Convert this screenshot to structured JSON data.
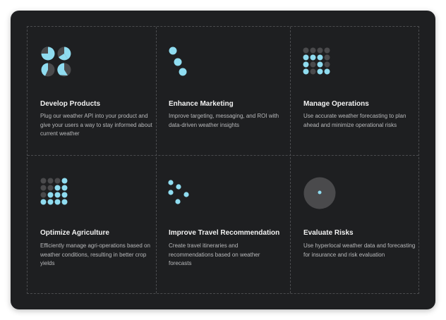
{
  "colors": {
    "accent": "#8fdcf0",
    "muted": "#4a4a4c",
    "panel": "#1e1f21"
  },
  "cards": [
    {
      "title": "Develop Products",
      "description": "Plug our weather API into your product and give your users a way to stay informed about current weather",
      "icon": "pie-charts-icon"
    },
    {
      "title": "Enhance Marketing",
      "description": "Improve targeting, messaging, and ROI with data-driven weather insights",
      "icon": "diagonal-dots-icon"
    },
    {
      "title": "Manage Operations",
      "description": "Use accurate weather forecasting to plan ahead and minimize operational risks",
      "icon": "dot-grid-icon"
    },
    {
      "title": "Optimize Agriculture",
      "description": "Efficiently manage agri-operations based on weather conditions, resulting in better crop yields",
      "icon": "dot-staircase-icon"
    },
    {
      "title": "Improve Travel Recommendation",
      "description": "Create travel itineraries and recommendations based on weather forecasts",
      "icon": "scattered-dots-icon"
    },
    {
      "title": "Evaluate Risks",
      "description": "Use hyperlocal weather data and forecasting for insurance and risk evaluation",
      "icon": "target-circle-icon"
    }
  ]
}
